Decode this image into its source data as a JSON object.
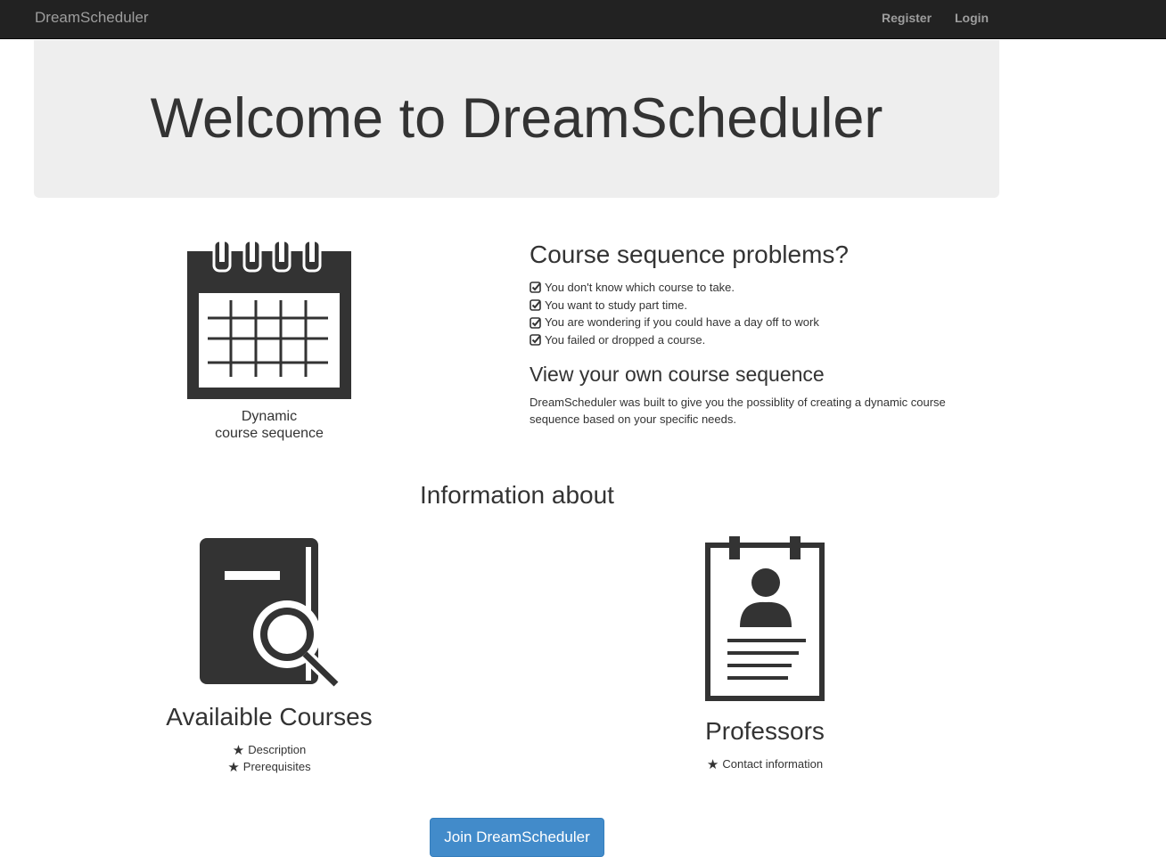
{
  "nav": {
    "brand": "DreamScheduler",
    "register": "Register",
    "login": "Login"
  },
  "jumbotron": {
    "title": "Welcome to DreamScheduler"
  },
  "calendar": {
    "caption_line1": "Dynamic",
    "caption_line2": "course sequence"
  },
  "problems": {
    "heading": "Course sequence problems?",
    "items": [
      "You don't know which course to take.",
      "You want to study part time.",
      "You are wondering if you could have a day off to work",
      "You failed or dropped a course."
    ]
  },
  "view": {
    "heading": "View your own course sequence",
    "text": "DreamScheduler was built to give you the possiblity of creating a dynamic course sequence based on your specific needs."
  },
  "info": {
    "heading": "Information about",
    "courses": {
      "title": "Availaible Courses",
      "items": [
        "Description",
        "Prerequisites"
      ]
    },
    "professors": {
      "title": "Professors",
      "items": [
        "Contact information"
      ]
    }
  },
  "cta": {
    "label": "Join DreamScheduler"
  },
  "colors": {
    "navbar": "#222222",
    "jumbotron": "#eeeeee",
    "icon": "#333333",
    "button": "#428bca"
  }
}
